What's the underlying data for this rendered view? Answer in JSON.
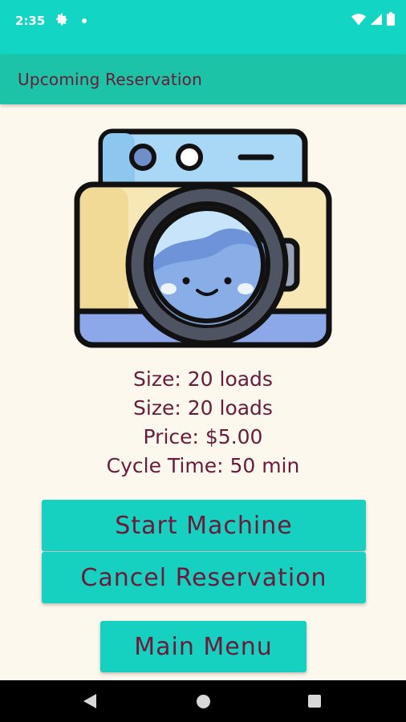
{
  "status_bar": {
    "time": "2:35",
    "icons": [
      "gear-icon",
      "notification-dot-icon",
      "wifi-icon",
      "cell-signal-icon",
      "battery-icon"
    ],
    "color": "#12D5C4"
  },
  "app_bar": {
    "title": "Upcoming Reservation",
    "color": "#1DC3A6",
    "title_color": "#6B1A3B"
  },
  "image": {
    "icon": "washing-machine-icon"
  },
  "reservation": {
    "lines": [
      "Size: 20 loads",
      "Size: 20 loads",
      "Price: $5.00",
      "Cycle Time: 50 min"
    ]
  },
  "actions": {
    "start_label": "Start Machine",
    "cancel_label": "Cancel Reservation",
    "menu_label": "Main Menu",
    "button_color": "#16D1BF"
  },
  "nav_bar": {
    "icons": [
      "back-icon",
      "home-icon",
      "recents-icon"
    ]
  }
}
